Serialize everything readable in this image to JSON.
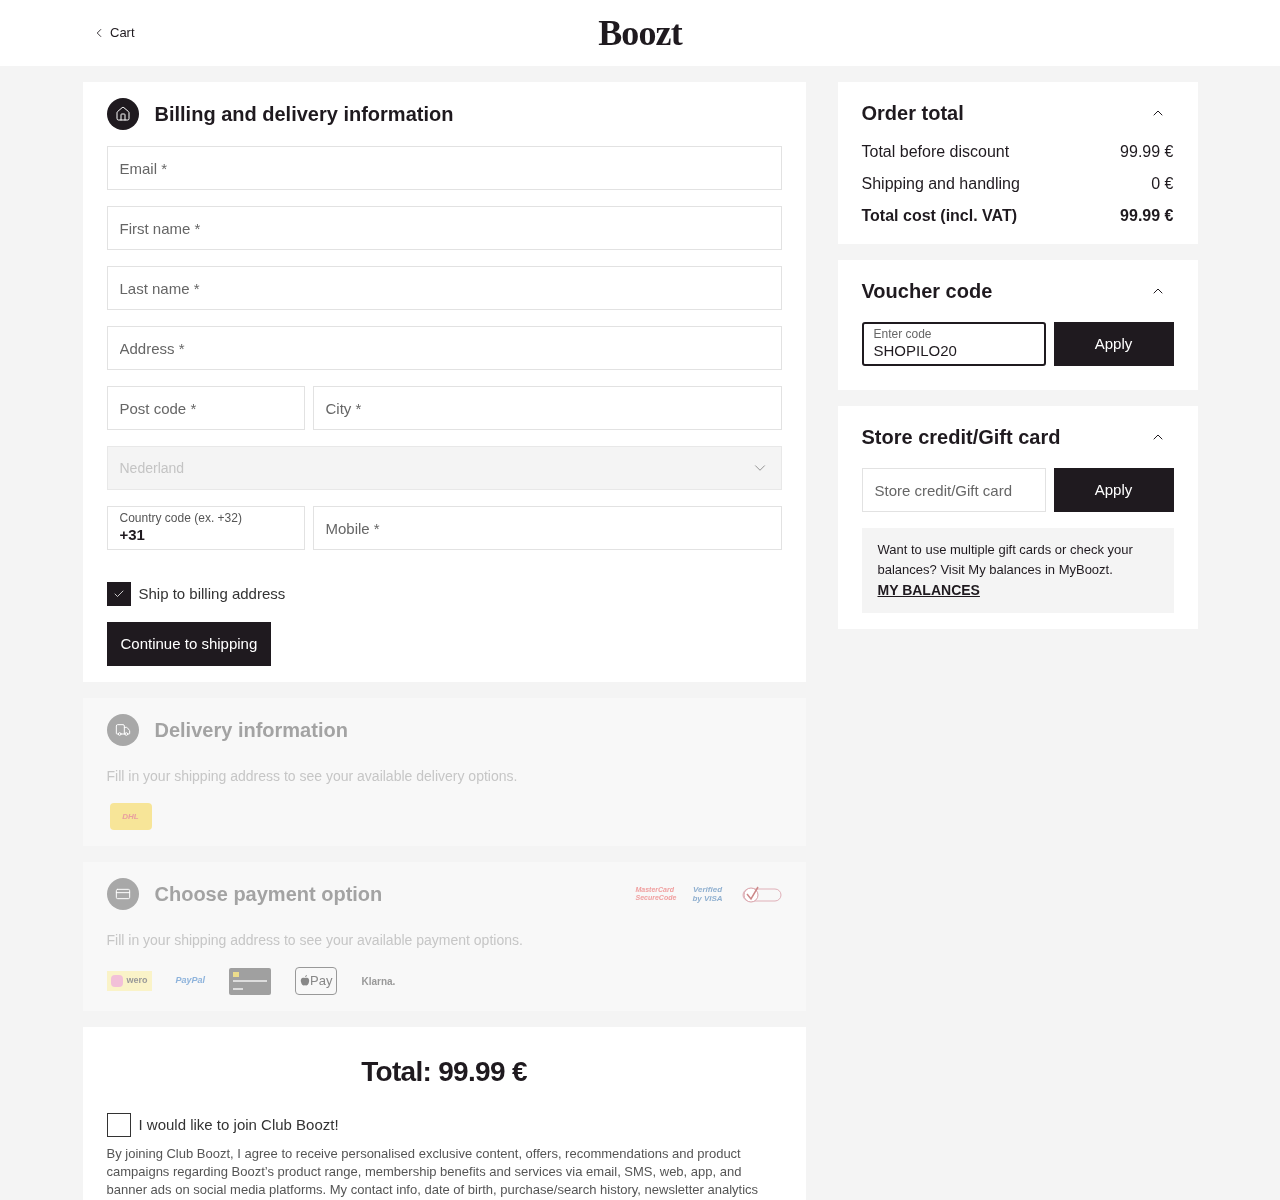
{
  "header": {
    "back_link": "Cart",
    "logo": "Boozt"
  },
  "billing": {
    "title": "Billing and delivery information",
    "fields": [
      {
        "kind": "text",
        "placeholder": "Email *"
      },
      {
        "kind": "text",
        "placeholder": "First name *"
      },
      {
        "kind": "text",
        "placeholder": "Last name *"
      },
      {
        "kind": "text",
        "placeholder": "Address *"
      },
      {
        "kind": "pair",
        "items": [
          {
            "placeholder": "Post code *"
          },
          {
            "placeholder": "City *"
          }
        ]
      },
      {
        "kind": "select",
        "value": "Nederland",
        "disabled": true
      },
      {
        "kind": "phone",
        "code_label": "Country code (ex. +32)",
        "code_value": "+31",
        "placeholder": "Mobile *"
      }
    ],
    "ship_to_billing": {
      "label": "Ship to billing address",
      "checked": true
    },
    "button": "Continue to shipping"
  },
  "delivery": {
    "title": "Delivery information",
    "disabled": true,
    "note": "Fill in your shipping address to see your available delivery options.",
    "carriers": [
      "DHL"
    ]
  },
  "payment": {
    "title": "Choose payment option",
    "disabled": true,
    "badges": [
      "MasterCard SecureCode",
      "Verified by VISA"
    ],
    "note": "Fill in your shipping address to see your available payment options.",
    "methods": [
      {
        "kind": "wero",
        "label": "wero"
      },
      {
        "kind": "paypal",
        "label": "PayPal"
      },
      {
        "kind": "card"
      },
      {
        "kind": "applepay",
        "label": "Pay"
      },
      {
        "kind": "klarna",
        "label": "Klarna."
      }
    ]
  },
  "summary": {
    "total": "Total: 99.99 €",
    "club": {
      "label": "I would like to join Club Boozt!",
      "checked": false
    },
    "consent": "By joining Club Boozt, I agree to receive personalised exclusive content, offers, recommendations and product campaigns regarding Boozt’s product range, membership benefits and services via email, SMS, web, app, and banner ads on social media platforms. My contact info, date of birth, purchase/search history, newsletter analytics"
  },
  "order_total": {
    "title": "Order total",
    "expanded": true,
    "rows": [
      {
        "label": "Total before discount",
        "value": "99.99 €",
        "bold": false
      },
      {
        "label": "Shipping and handling",
        "value": "0 €",
        "bold": false
      },
      {
        "label": "Total cost (incl. VAT)",
        "value": "99.99 €",
        "bold": true
      }
    ]
  },
  "voucher": {
    "title": "Voucher code",
    "expanded": true,
    "label": "Enter code",
    "value": "SHOPILO20",
    "button": "Apply"
  },
  "gift_card": {
    "title": "Store credit/Gift card",
    "expanded": true,
    "placeholder": "Store credit/Gift card",
    "button": "Apply",
    "info": "Want to use multiple gift cards or check your balances? Visit My balances in MyBoozt.",
    "link": "MY BALANCES"
  }
}
